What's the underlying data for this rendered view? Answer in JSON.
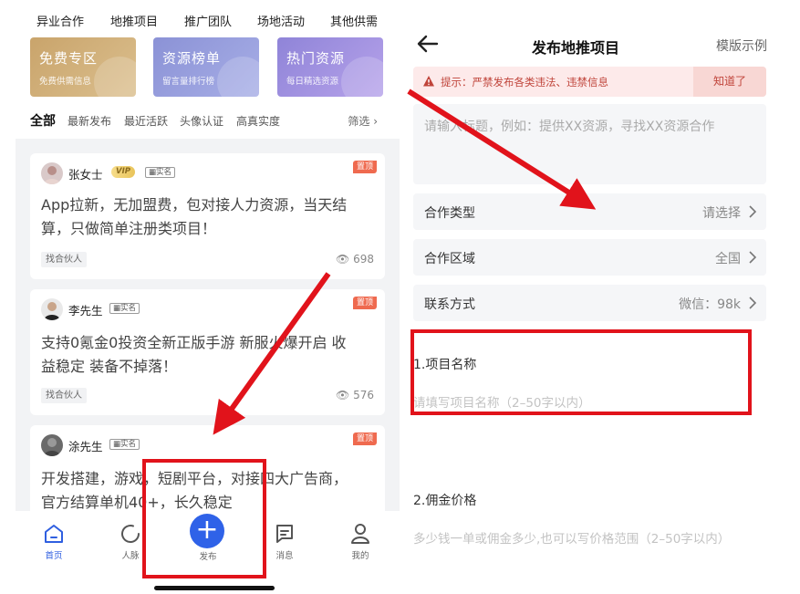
{
  "left": {
    "top_nav": [
      "异业合作",
      "地推项目",
      "推广团队",
      "场地活动",
      "其他供需"
    ],
    "banners": [
      {
        "title": "免费专区",
        "subtitle": "免费供需信息"
      },
      {
        "title": "资源榜单",
        "subtitle": "留言量排行榜"
      },
      {
        "title": "热门资源",
        "subtitle": "每日精选资源"
      }
    ],
    "filters": [
      "全部",
      "最新发布",
      "最近活跃",
      "头像认证",
      "高真实度"
    ],
    "filter_button": "筛选 ›",
    "posts": [
      {
        "name": "张女士",
        "vip": "VIP",
        "verify": "实名",
        "badge": "置顶",
        "body_line1": "App拉新，无加盟费，包对接人力资源，当天结",
        "body_line2": "算，只做简单注册类项目！",
        "tag": "找合伙人",
        "views": "698"
      },
      {
        "name": "李先生",
        "verify": "实名",
        "badge": "置顶",
        "body_line1": "支持0氪金0投资全新正版手游 新服火爆开启 收",
        "body_line2": "益稳定 装备不掉落！",
        "tag": "找合伙人",
        "views": "576"
      },
      {
        "name": "涂先生",
        "verify": "实名",
        "badge": "置顶",
        "body_line1": "开发搭建，游戏，短剧平台，对接四大广告商，",
        "body_line2": "官方结算单机40+，长久稳定"
      }
    ],
    "tabs": [
      {
        "label": "首页",
        "icon": "home-icon"
      },
      {
        "label": "人脉",
        "icon": "contacts-icon"
      },
      {
        "label": "发布",
        "icon": "plus-icon"
      },
      {
        "label": "消息",
        "icon": "message-icon"
      },
      {
        "label": "我的",
        "icon": "user-icon"
      }
    ]
  },
  "right": {
    "title": "发布地推项目",
    "template_link": "模版示例",
    "notice_text": "提示：严禁发布各类违法、违禁信息",
    "notice_button": "知道了",
    "title_placeholder": "请输入标题，例如：提供XX资源，寻找XX资源合作",
    "rows": [
      {
        "label": "合作类型",
        "value": "请选择"
      },
      {
        "label": "合作区域",
        "value": "全国"
      },
      {
        "label": "联系方式",
        "value": "微信：98k"
      }
    ],
    "section1_label": "1.项目名称",
    "section1_placeholder": "请填写项目名称（2–50字以内）",
    "section2_label": "2.佣金价格",
    "section2_placeholder": "多少钱一单或佣金多少,也可以写价格范围（2–50字以内）"
  },
  "colors": {
    "accent": "#2f62e8",
    "annotation_red": "#e1131b",
    "notice_bg": "#fdeaea",
    "top_badge": "#ef6a4f"
  }
}
